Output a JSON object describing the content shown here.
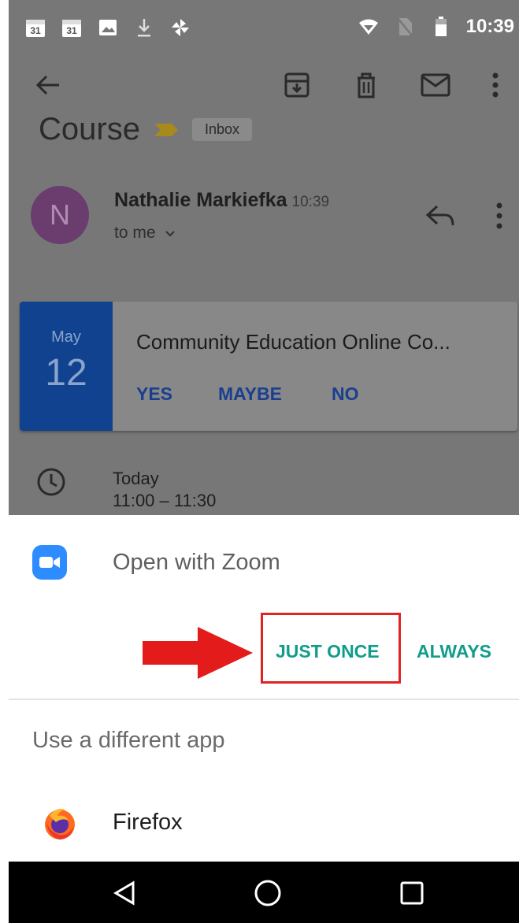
{
  "status_bar": {
    "time": "10:39",
    "left_icons": [
      "calendar-31-icon",
      "calendar-31-icon",
      "image-icon",
      "download-icon",
      "pinwheel-icon"
    ],
    "right_icons": [
      "wifi-icon",
      "no-sim-icon",
      "battery-icon"
    ],
    "calendar_day": "31"
  },
  "toolbar": {
    "icons": [
      "back-arrow-icon",
      "archive-icon",
      "delete-icon",
      "mark-unread-icon",
      "more-vert-icon"
    ]
  },
  "email": {
    "subject": "Course",
    "inbox_label": "Inbox",
    "sender_initial": "N",
    "sender_name": "Nathalie Markiefka",
    "sent_time": "10:39",
    "recipient": "to me"
  },
  "event": {
    "month": "May",
    "day": "12",
    "title": "Community Education Online Co...",
    "rsvp_yes": "YES",
    "rsvp_maybe": "MAYBE",
    "rsvp_no": "NO",
    "when_day": "Today",
    "when_time": "11:00 – 11:30"
  },
  "chooser": {
    "primary_app": "Open with Zoom",
    "just_once": "JUST ONCE",
    "always": "ALWAYS",
    "different_app_heading": "Use a different app",
    "alt_app": "Firefox"
  },
  "colors": {
    "accent": "#0f9d8a",
    "highlight": "#e02424",
    "zoom_blue": "#2d8cff",
    "event_blue": "#10428f"
  }
}
